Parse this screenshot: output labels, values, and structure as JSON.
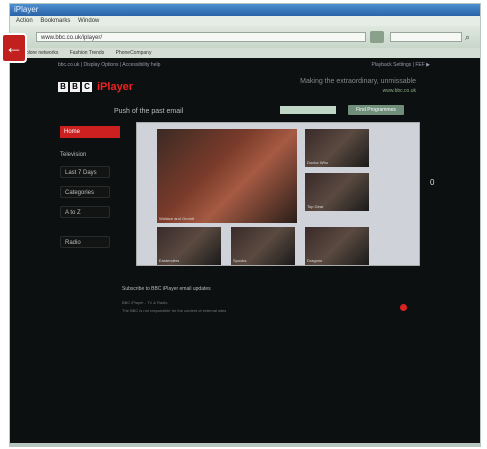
{
  "window": {
    "title": "iPlayer"
  },
  "browser": {
    "menu": [
      "Action",
      "Bookmarks",
      "Window"
    ],
    "address": "www.bbc.co.uk/iplayer/",
    "favorites": [
      "Explore networks",
      "Fashion Trends",
      "PhoneCompany"
    ]
  },
  "page": {
    "topnav": "bbc.co.uk  |  Display Options  |  Accessibility help",
    "topright": "Playback Settings  |  FEF ▶",
    "logo": {
      "letters": [
        "B",
        "B",
        "C"
      ],
      "product": "iPlayer"
    },
    "tagline": "Making the extraordinary, unmissable",
    "tagline_sub": "www.bbc.co.uk",
    "email_prompt": "Push of the past email",
    "email_button": "Find Programmes",
    "sidebar": {
      "home": "Home",
      "tv_label": "Television",
      "items": [
        "Last 7 Days",
        "Categories",
        "A to Z",
        "Radio"
      ]
    },
    "featured": {
      "main_caption": "Wallace and Gromit",
      "tiles": [
        {
          "caption": "Doctor Who"
        },
        {
          "caption": "Top Gear"
        },
        {
          "caption": "Eastenders"
        },
        {
          "caption": "Spooks"
        },
        {
          "caption": "Dragons"
        }
      ]
    },
    "subscribe": "Subscribe to BBC iPlayer email updates",
    "footer_lines": [
      "BBC iPlayer - TV & Radio",
      "The BBC is not responsible for the content of external sites"
    ],
    "side_counter": "0"
  },
  "colors": {
    "brand_red": "#cc2020",
    "background": "#0d1010"
  }
}
